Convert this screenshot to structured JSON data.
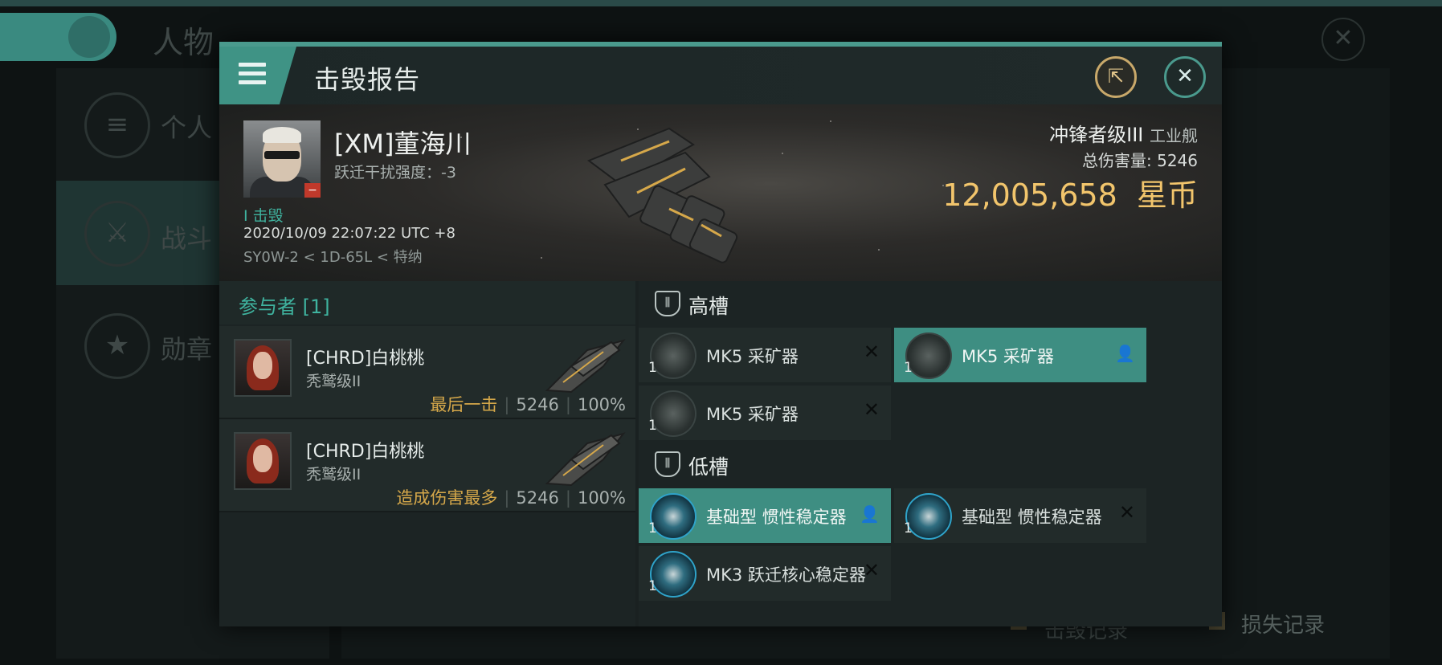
{
  "background": {
    "title": "人物",
    "sidebar": [
      "个人",
      "战斗",
      "勋章"
    ],
    "footer_left": "击毁记录",
    "footer_right": "损失记录"
  },
  "modal": {
    "title": "击毁报告",
    "victim": {
      "name": "[XM]董海川",
      "warp_disruption": "跃迁干扰强度：-3",
      "kill_tag": "I 击毁",
      "timestamp": "2020/10/09 22:07:22 UTC +8",
      "location": "SY0W-2 < 1D-65L < 特纳"
    },
    "ship": {
      "name": "冲锋者级III",
      "class": "工业舰",
      "total_damage": "总伤害量: 5246",
      "value": "12,005,658",
      "currency": "星币"
    },
    "participants": {
      "header": "参与者 [1]",
      "rows": [
        {
          "name": "[CHRD]白桃桃",
          "ship": "秃鹫级II",
          "tag": "最后一击",
          "damage": "5246",
          "percent": "100%"
        },
        {
          "name": "[CHRD]白桃桃",
          "ship": "秃鹫级II",
          "tag": "造成伤害最多",
          "damage": "5246",
          "percent": "100%"
        }
      ]
    },
    "high_slots": {
      "label": "高槽",
      "modules": [
        {
          "qty": "1",
          "name": "MK5 采矿器"
        },
        {
          "qty": "1",
          "name": "MK5 采矿器"
        },
        {
          "qty": "1",
          "name": "MK5 采矿器"
        }
      ]
    },
    "low_slots": {
      "label": "低槽",
      "modules": [
        {
          "qty": "1",
          "name": "基础型 惯性稳定器"
        },
        {
          "qty": "1",
          "name": "基础型 惯性稳定器"
        },
        {
          "qty": "1",
          "name": "MK3 跃迁核心稳定器"
        }
      ]
    }
  }
}
